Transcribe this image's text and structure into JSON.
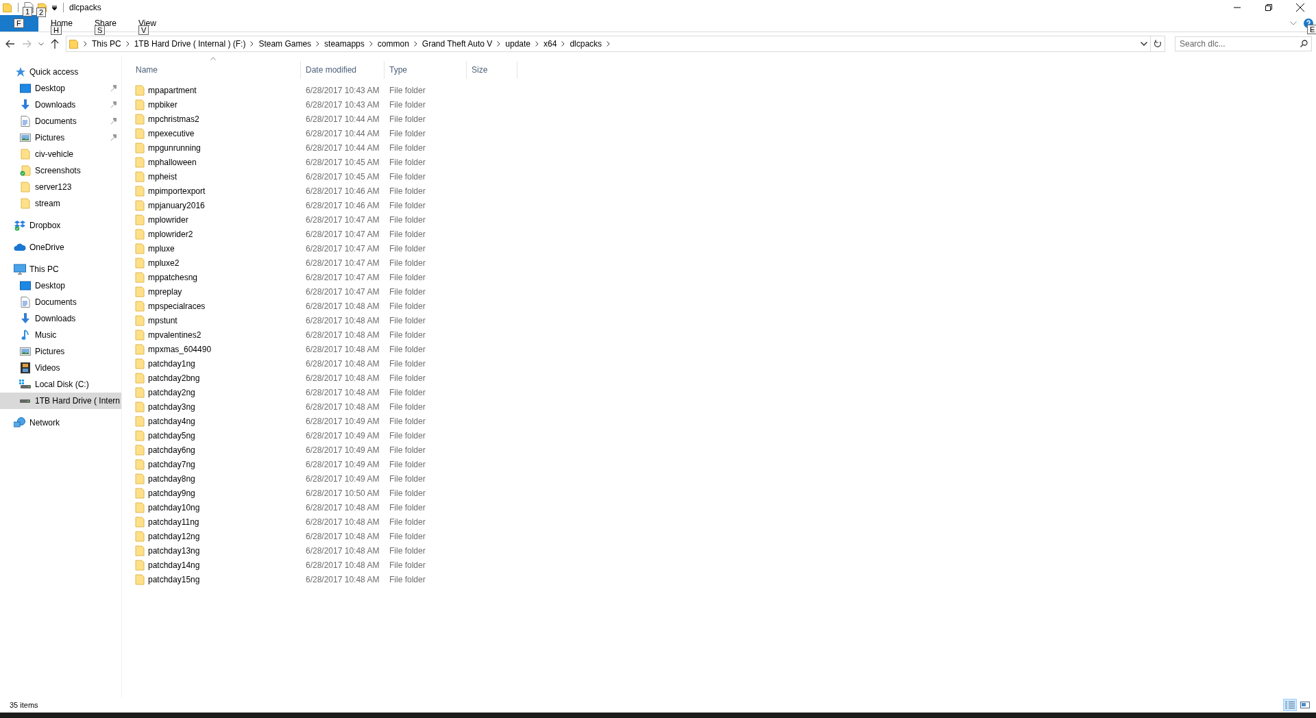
{
  "window": {
    "title": "dlcpacks",
    "quick_keytips": [
      "1",
      "2"
    ]
  },
  "ribbon": {
    "tabs": [
      {
        "kind": "file",
        "keytip": "F"
      },
      {
        "kind": "tab",
        "label": "Home",
        "keytip": "H"
      },
      {
        "kind": "tab",
        "label": "Share",
        "keytip": "S"
      },
      {
        "kind": "tab",
        "label": "View",
        "keytip": "V"
      }
    ],
    "help_keytip": "E"
  },
  "address": {
    "segments": [
      "This PC",
      "1TB Hard Drive ( Internal ) (F:)",
      "Steam Games",
      "steamapps",
      "common",
      "Grand Theft Auto V",
      "update",
      "x64",
      "dlcpacks"
    ],
    "search_placeholder": "Search dlc..."
  },
  "sidebar": {
    "items": [
      {
        "label": "Quick access",
        "kind": "star",
        "selected": false,
        "children": [
          {
            "label": "Desktop",
            "kind": "desktop",
            "pinned": true,
            "selected": false
          },
          {
            "label": "Downloads",
            "kind": "download",
            "pinned": true,
            "selected": false
          },
          {
            "label": "Documents",
            "kind": "document",
            "pinned": true,
            "selected": false
          },
          {
            "label": "Pictures",
            "kind": "pictures",
            "pinned": true,
            "selected": false
          },
          {
            "label": "civ-vehicle",
            "kind": "folder",
            "pinned": false,
            "selected": false
          },
          {
            "label": "Screenshots",
            "kind": "folder-synced",
            "pinned": false,
            "selected": false
          },
          {
            "label": "server123",
            "kind": "folder",
            "pinned": false,
            "selected": false
          },
          {
            "label": "stream",
            "kind": "folder",
            "pinned": false,
            "selected": false
          }
        ]
      },
      {
        "label": "Dropbox",
        "kind": "dropbox",
        "selected": false
      },
      {
        "label": "OneDrive",
        "kind": "cloud",
        "selected": false
      },
      {
        "label": "This PC",
        "kind": "pc",
        "selected": false,
        "children": [
          {
            "label": "Desktop",
            "kind": "desktop",
            "selected": false
          },
          {
            "label": "Documents",
            "kind": "document",
            "selected": false
          },
          {
            "label": "Downloads",
            "kind": "download",
            "selected": false
          },
          {
            "label": "Music",
            "kind": "music",
            "selected": false
          },
          {
            "label": "Pictures",
            "kind": "pictures",
            "selected": false
          },
          {
            "label": "Videos",
            "kind": "video",
            "selected": false
          },
          {
            "label": "Local Disk (C:)",
            "kind": "system-drive",
            "selected": false
          },
          {
            "label": "1TB Hard Drive ( Intern",
            "kind": "drive",
            "selected": true
          }
        ]
      },
      {
        "label": "Network",
        "kind": "network",
        "selected": false
      }
    ]
  },
  "table": {
    "columns": [
      {
        "label": "Name",
        "sorted": true
      },
      {
        "label": "Date modified",
        "sorted": false
      },
      {
        "label": "Type",
        "sorted": false
      },
      {
        "label": "Size",
        "sorted": false
      }
    ],
    "rows": [
      {
        "name": "mpapartment",
        "date": "6/28/2017 10:43 AM",
        "type": "File folder"
      },
      {
        "name": "mpbiker",
        "date": "6/28/2017 10:43 AM",
        "type": "File folder"
      },
      {
        "name": "mpchristmas2",
        "date": "6/28/2017 10:44 AM",
        "type": "File folder"
      },
      {
        "name": "mpexecutive",
        "date": "6/28/2017 10:44 AM",
        "type": "File folder"
      },
      {
        "name": "mpgunrunning",
        "date": "6/28/2017 10:44 AM",
        "type": "File folder"
      },
      {
        "name": "mphalloween",
        "date": "6/28/2017 10:45 AM",
        "type": "File folder"
      },
      {
        "name": "mpheist",
        "date": "6/28/2017 10:45 AM",
        "type": "File folder"
      },
      {
        "name": "mpimportexport",
        "date": "6/28/2017 10:46 AM",
        "type": "File folder"
      },
      {
        "name": "mpjanuary2016",
        "date": "6/28/2017 10:46 AM",
        "type": "File folder"
      },
      {
        "name": "mplowrider",
        "date": "6/28/2017 10:47 AM",
        "type": "File folder"
      },
      {
        "name": "mplowrider2",
        "date": "6/28/2017 10:47 AM",
        "type": "File folder"
      },
      {
        "name": "mpluxe",
        "date": "6/28/2017 10:47 AM",
        "type": "File folder"
      },
      {
        "name": "mpluxe2",
        "date": "6/28/2017 10:47 AM",
        "type": "File folder"
      },
      {
        "name": "mppatchesng",
        "date": "6/28/2017 10:47 AM",
        "type": "File folder"
      },
      {
        "name": "mpreplay",
        "date": "6/28/2017 10:47 AM",
        "type": "File folder"
      },
      {
        "name": "mpspecialraces",
        "date": "6/28/2017 10:48 AM",
        "type": "File folder"
      },
      {
        "name": "mpstunt",
        "date": "6/28/2017 10:48 AM",
        "type": "File folder"
      },
      {
        "name": "mpvalentines2",
        "date": "6/28/2017 10:48 AM",
        "type": "File folder"
      },
      {
        "name": "mpxmas_604490",
        "date": "6/28/2017 10:48 AM",
        "type": "File folder"
      },
      {
        "name": "patchday1ng",
        "date": "6/28/2017 10:48 AM",
        "type": "File folder"
      },
      {
        "name": "patchday2bng",
        "date": "6/28/2017 10:48 AM",
        "type": "File folder"
      },
      {
        "name": "patchday2ng",
        "date": "6/28/2017 10:48 AM",
        "type": "File folder"
      },
      {
        "name": "patchday3ng",
        "date": "6/28/2017 10:48 AM",
        "type": "File folder"
      },
      {
        "name": "patchday4ng",
        "date": "6/28/2017 10:49 AM",
        "type": "File folder"
      },
      {
        "name": "patchday5ng",
        "date": "6/28/2017 10:49 AM",
        "type": "File folder"
      },
      {
        "name": "patchday6ng",
        "date": "6/28/2017 10:49 AM",
        "type": "File folder"
      },
      {
        "name": "patchday7ng",
        "date": "6/28/2017 10:49 AM",
        "type": "File folder"
      },
      {
        "name": "patchday8ng",
        "date": "6/28/2017 10:49 AM",
        "type": "File folder"
      },
      {
        "name": "patchday9ng",
        "date": "6/28/2017 10:50 AM",
        "type": "File folder"
      },
      {
        "name": "patchday10ng",
        "date": "6/28/2017 10:48 AM",
        "type": "File folder"
      },
      {
        "name": "patchday11ng",
        "date": "6/28/2017 10:48 AM",
        "type": "File folder"
      },
      {
        "name": "patchday12ng",
        "date": "6/28/2017 10:48 AM",
        "type": "File folder"
      },
      {
        "name": "patchday13ng",
        "date": "6/28/2017 10:48 AM",
        "type": "File folder"
      },
      {
        "name": "patchday14ng",
        "date": "6/28/2017 10:48 AM",
        "type": "File folder"
      },
      {
        "name": "patchday15ng",
        "date": "6/28/2017 10:48 AM",
        "type": "File folder"
      }
    ]
  },
  "status_bar": {
    "count": "35 items",
    "views": [
      {
        "kind": "details",
        "selected": true
      },
      {
        "kind": "large-icons",
        "selected": false
      }
    ]
  }
}
